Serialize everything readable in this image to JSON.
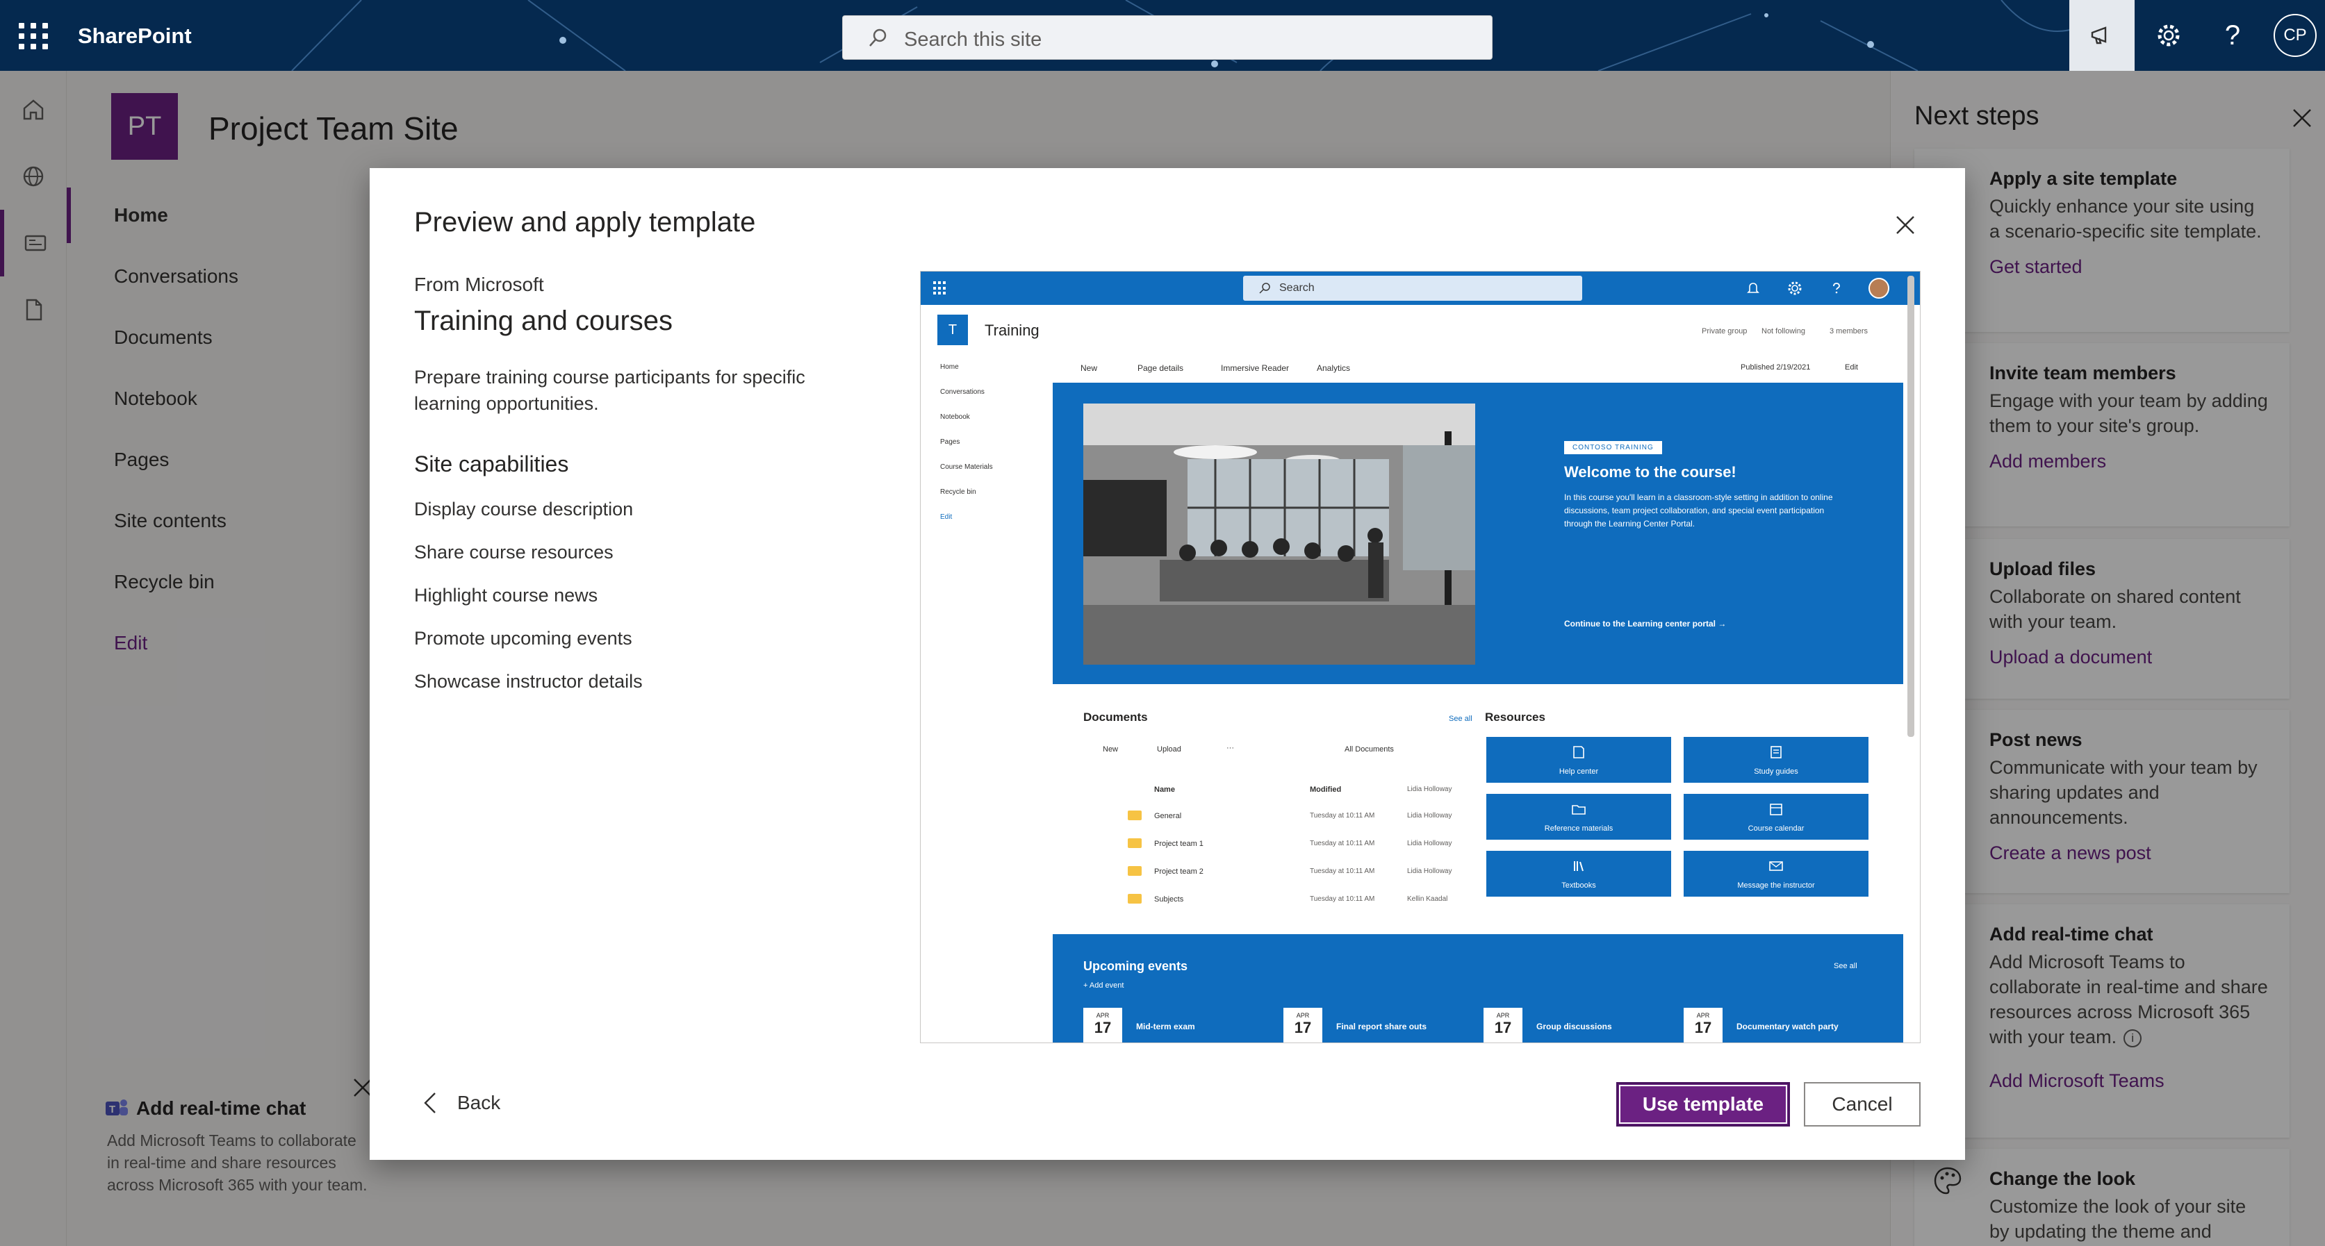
{
  "suitebar": {
    "app_name": "SharePoint",
    "search_placeholder": "Search this site",
    "avatar_initials": "CP",
    "help_glyph": "?"
  },
  "site": {
    "logo_initials": "PT",
    "title": "Project Team Site"
  },
  "nav": {
    "items": [
      {
        "label": "Home",
        "selected": true
      },
      {
        "label": "Conversations"
      },
      {
        "label": "Documents"
      },
      {
        "label": "Notebook"
      },
      {
        "label": "Pages"
      },
      {
        "label": "Site contents"
      },
      {
        "label": "Recycle bin"
      },
      {
        "label": "Edit"
      }
    ]
  },
  "teams_prompt": {
    "title": "Add real-time chat",
    "text": "Add Microsoft Teams to collaborate in real-time and share resources across Microsoft 365 with your team."
  },
  "next_steps": {
    "title": "Next steps",
    "cards": [
      {
        "title": "Apply a site template",
        "desc": "Quickly enhance your site using a scenario-specific site template.",
        "link": "Get started"
      },
      {
        "title": "Invite team members",
        "desc": "Engage with your team by adding them to your site's group.",
        "link": "Add members"
      },
      {
        "title": "Upload files",
        "desc": "Collaborate on shared content with your team.",
        "link": "Upload a document"
      },
      {
        "title": "Post news",
        "desc": "Communicate with your team by sharing updates and announcements.",
        "link": "Create a news post"
      },
      {
        "title": "Add real-time chat",
        "desc": "Add Microsoft Teams to collaborate in real-time and share resources across Microsoft 365 with your team.",
        "link": "Add Microsoft Teams"
      },
      {
        "title": "Change the look",
        "desc": "Customize the look of your site by updating the theme and",
        "link": ""
      }
    ]
  },
  "dialog": {
    "title": "Preview and apply template",
    "from": "From Microsoft",
    "template_name": "Training and courses",
    "description": "Prepare training course participants for specific learning opportunities.",
    "capabilities_heading": "Site capabilities",
    "capabilities": [
      "Display course description",
      "Share course resources",
      "Highlight course news",
      "Promote upcoming events",
      "Showcase instructor details"
    ],
    "back_label": "Back",
    "use_template_label": "Use template",
    "cancel_label": "Cancel"
  },
  "preview": {
    "search": "Search",
    "logo": "T",
    "site_title": "Training",
    "meta": [
      "Private group",
      "Not following",
      "3 members"
    ],
    "nav": [
      "Home",
      "Conversations",
      "Notebook",
      "Pages",
      "Course Materials",
      "Recycle bin",
      "Edit"
    ],
    "commands": [
      "New",
      "Page details",
      "Immersive Reader",
      "Analytics"
    ],
    "published": "Published 2/19/2021",
    "edit": "Edit",
    "hero": {
      "tag": "CONTOSO TRAINING",
      "heading": "Welcome to the course!",
      "text": "In this course you'll learn in a classroom-style setting in addition to online discussions, team project collaboration, and special event participation through the Learning Center Portal.",
      "link": "Continue to the Learning center portal →"
    },
    "documents": {
      "heading": "Documents",
      "see_all": "See all",
      "toolbar": [
        "New",
        "Upload",
        "···",
        "All Documents"
      ],
      "col_name": "Name",
      "col_modified": "Modified",
      "col_modified_by": "Lidia Holloway",
      "rows": [
        {
          "name": "General",
          "modified": "Tuesday at 10:11 AM",
          "by": "Lidia Holloway"
        },
        {
          "name": "Project team 1",
          "modified": "Tuesday at 10:11 AM",
          "by": "Lidia Holloway"
        },
        {
          "name": "Project team 2",
          "modified": "Tuesday at 10:11 AM",
          "by": "Lidia Holloway"
        },
        {
          "name": "Subjects",
          "modified": "Tuesday at 10:11 AM",
          "by": "Kellin Kaadal"
        }
      ]
    },
    "resources": {
      "heading": "Resources",
      "items": [
        "Help center",
        "Study guides",
        "Reference materials",
        "Course calendar",
        "Textbooks",
        "Message the instructor"
      ]
    },
    "events": {
      "heading": "Upcoming events",
      "add": "+ Add event",
      "see_all": "See all",
      "items": [
        {
          "month": "APR",
          "day": "17",
          "name": "Mid-term exam"
        },
        {
          "month": "APR",
          "day": "17",
          "name": "Final report share outs"
        },
        {
          "month": "APR",
          "day": "17",
          "name": "Group discussions"
        },
        {
          "month": "APR",
          "day": "17",
          "name": "Documentary watch party"
        }
      ]
    }
  }
}
